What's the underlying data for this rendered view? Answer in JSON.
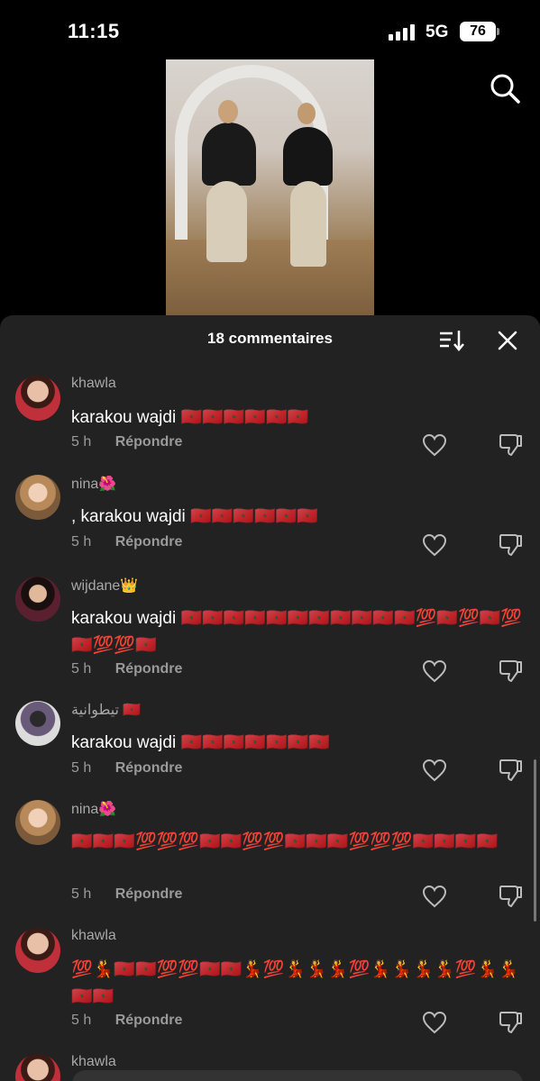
{
  "status_bar": {
    "time": "11:15",
    "network": "5G",
    "battery": "76"
  },
  "video": {
    "description_icon": "video-thumbnail"
  },
  "comments_panel": {
    "title": "18 commentaires",
    "sort_icon": "sort-icon",
    "close_icon": "close-icon"
  },
  "comments": [
    {
      "username": "khawla",
      "text": "karakou wajdi 🇲🇦🇲🇦🇲🇦🇲🇦🇲🇦🇲🇦",
      "time": "5 h",
      "reply": "Répondre",
      "avatar_color": "#c0303a"
    },
    {
      "username": "nina🌺",
      "text": ", karakou wajdi 🇲🇦🇲🇦🇲🇦🇲🇦🇲🇦🇲🇦",
      "time": "5 h",
      "reply": "Répondre",
      "avatar_color": "#c9a07a"
    },
    {
      "username": "wijdane👑",
      "text": "karakou wajdi 🇲🇦🇲🇦🇲🇦🇲🇦🇲🇦🇲🇦🇲🇦🇲🇦🇲🇦🇲🇦🇲🇦💯🇲🇦💯🇲🇦💯🇲🇦💯💯🇲🇦",
      "time": "5 h",
      "reply": "Répondre",
      "avatar_color": "#5a2030"
    },
    {
      "username": "تيطوانية 🇲🇦",
      "text": "karakou wajdi 🇲🇦🇲🇦🇲🇦🇲🇦🇲🇦🇲🇦🇲🇦",
      "time": "5 h",
      "reply": "Répondre",
      "avatar_color": "#6a5a7a"
    },
    {
      "username": "nina🌺",
      "text": "🇲🇦🇲🇦🇲🇦💯💯💯🇲🇦🇲🇦💯💯🇲🇦🇲🇦🇲🇦💯💯💯🇲🇦🇲🇦🇲🇦🇲🇦",
      "time": "5 h",
      "reply": "Répondre",
      "avatar_color": "#c9a07a"
    },
    {
      "username": "khawla",
      "text": "💯💃🇲🇦🇲🇦💯💯🇲🇦🇲🇦💃💯💃💃💃💯💃💃💃💃💯💃💃🇲🇦🇲🇦",
      "time": "5 h",
      "reply": "Répondre",
      "avatar_color": "#c0303a"
    },
    {
      "username": "khawla",
      "text": "",
      "time": "",
      "reply": "",
      "avatar_color": "#c0303a"
    }
  ]
}
